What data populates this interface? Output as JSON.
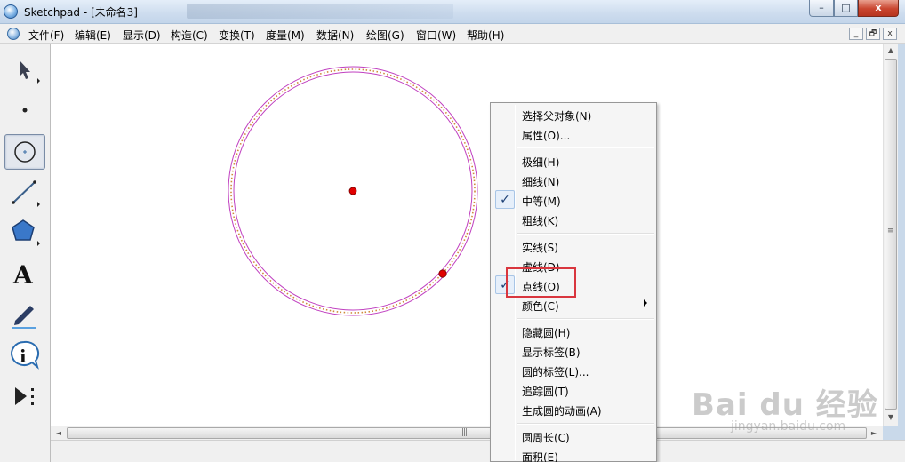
{
  "window": {
    "title": "Sketchpad  - [未命名3]",
    "btn_minimize": "–",
    "btn_maximize": "□",
    "btn_close": "x"
  },
  "menubar": {
    "items": [
      {
        "label": "文件(F)"
      },
      {
        "label": "编辑(E)"
      },
      {
        "label": "显示(D)"
      },
      {
        "label": "构造(C)"
      },
      {
        "label": "变换(T)"
      },
      {
        "label": "度量(M)"
      },
      {
        "label": "数据(N)"
      },
      {
        "label": "绘图(G)"
      },
      {
        "label": "窗口(W)"
      },
      {
        "label": "帮助(H)"
      }
    ],
    "mdi_minimize": "_",
    "mdi_restore": "🗗",
    "mdi_close": "x"
  },
  "toolbox": {
    "tools": [
      {
        "name": "selection-arrow-tool",
        "icon": "arrow-icon"
      },
      {
        "name": "point-tool",
        "icon": "point-icon"
      },
      {
        "name": "compass-tool",
        "icon": "circle-icon",
        "selected": true
      },
      {
        "name": "straightedge-tool",
        "icon": "line-icon"
      },
      {
        "name": "polygon-tool",
        "icon": "pentagon-icon"
      },
      {
        "name": "text-tool",
        "icon": "text-a-icon",
        "glyph": "A"
      },
      {
        "name": "marker-tool",
        "icon": "pen-icon"
      },
      {
        "name": "information-tool",
        "icon": "info-icon",
        "glyph": "i"
      },
      {
        "name": "custom-tool",
        "icon": "play-menu-icon"
      }
    ]
  },
  "canvas": {
    "circle": {
      "center_color": "#e00000",
      "stroke_color": "#c040c0",
      "dot_color": "#d08a3a",
      "style": "dotted"
    }
  },
  "context_menu": {
    "items": [
      {
        "label": "选择父对象(N)",
        "checked": false
      },
      {
        "label": "属性(O)...",
        "checked": false
      },
      {
        "separator": true
      },
      {
        "label": "极细(H)",
        "checked": false
      },
      {
        "label": "细线(N)",
        "checked": false
      },
      {
        "label": "中等(M)",
        "checked": true
      },
      {
        "label": "粗线(K)",
        "checked": false
      },
      {
        "separator": true
      },
      {
        "label": "实线(S)",
        "checked": false
      },
      {
        "label": "虚线(D)",
        "checked": false
      },
      {
        "label": "点线(O)",
        "checked": true
      },
      {
        "label": "颜色(C)",
        "checked": false,
        "submenu": true
      },
      {
        "separator": true
      },
      {
        "label": "隐藏圆(H)",
        "checked": false
      },
      {
        "label": "显示标签(B)",
        "checked": false
      },
      {
        "label": "圆的标签(L)...",
        "checked": false
      },
      {
        "label": "追踪圆(T)",
        "checked": false
      },
      {
        "label": "生成圆的动画(A)",
        "checked": false
      },
      {
        "separator": true
      },
      {
        "label": "圆周长(C)",
        "checked": false
      },
      {
        "label": "面积(E)",
        "checked": false
      }
    ],
    "check_glyph": "✓",
    "highlight_color": "#d9363e"
  },
  "scrollbars": {
    "up": "▲",
    "down": "▼",
    "left": "◄",
    "right": "►",
    "grip": "|||",
    "vgrip": "≡"
  },
  "watermark": {
    "main": "Bai du 经验",
    "sub": "jingyan.baidu.com"
  }
}
